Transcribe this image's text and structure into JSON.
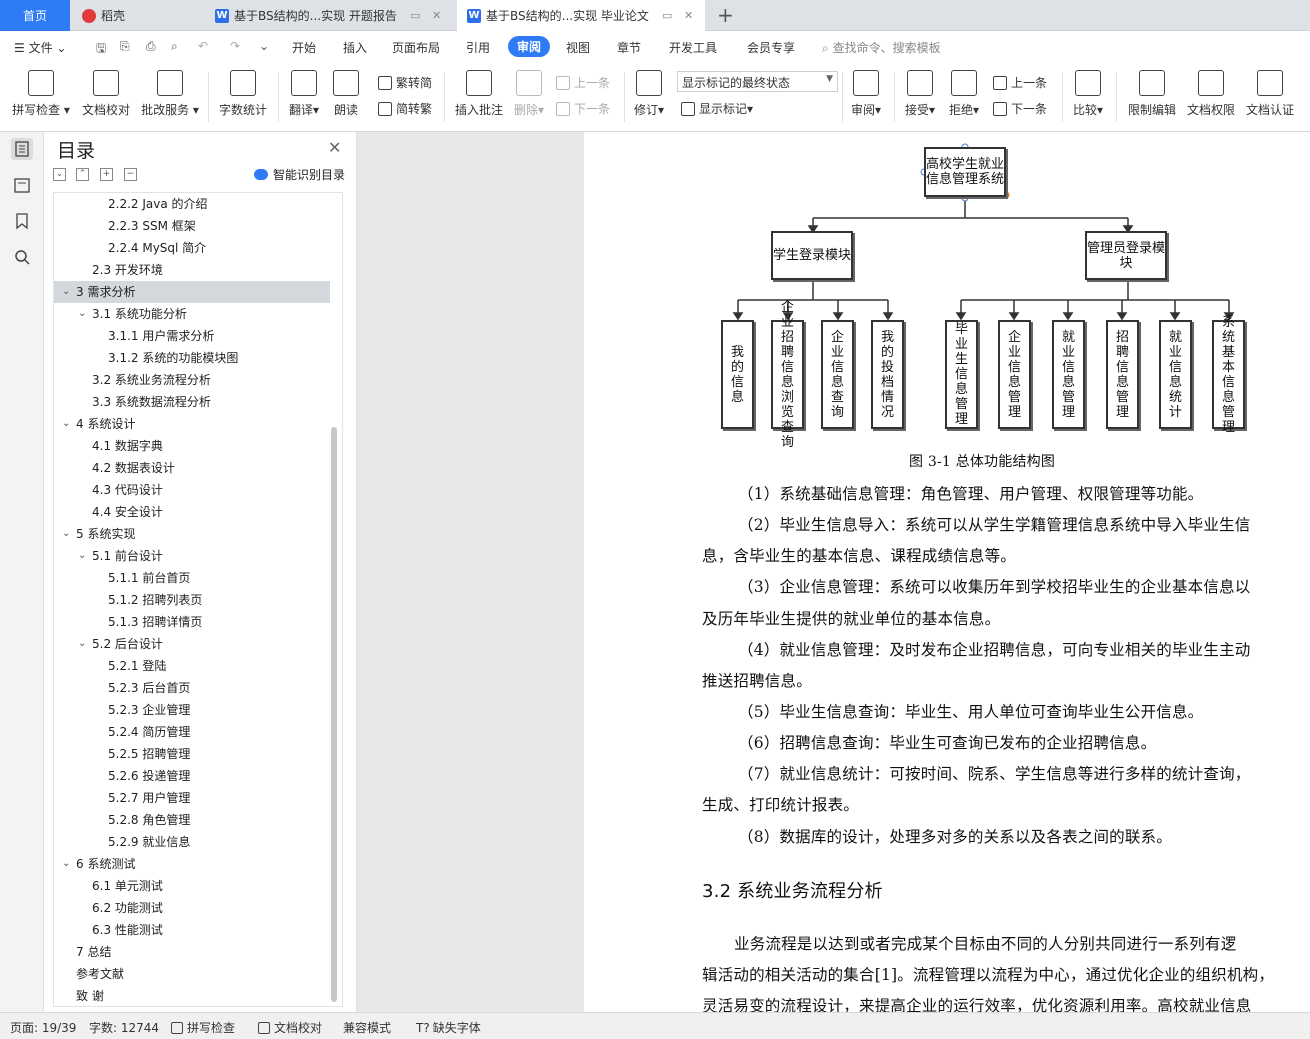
{
  "tabs": [
    {
      "label": "首页"
    },
    {
      "label": "稻壳"
    },
    {
      "label": "基于BS结构的...实现 开题报告"
    },
    {
      "label": "基于BS结构的...实现 毕业论文"
    }
  ],
  "menu": {
    "file": "文件",
    "items": [
      "开始",
      "插入",
      "页面布局",
      "引用",
      "审阅",
      "视图",
      "章节",
      "开发工具",
      "会员专享"
    ],
    "active": "审阅",
    "search_placeholder": "查找命令、搜索模板"
  },
  "ribbon": {
    "spell": "拼写检查",
    "doccheck": "文档校对",
    "correction": "批改服务",
    "wordcount": "字数统计",
    "translate": "翻译",
    "read": "朗读",
    "trad": "繁转简",
    "simp": "简转繁",
    "insert_comment": "插入批注",
    "delete": "删除",
    "prev_comment": "上一条",
    "next_comment": "下一条",
    "revise": "修订",
    "status_select": "显示标记的最终状态",
    "show_marks": "显示标记",
    "review": "审阅",
    "accept": "接受",
    "reject": "拒绝",
    "prev": "上一条",
    "next": "下一条",
    "compare": "比较",
    "restrict": "限制编辑",
    "permission": "文档权限",
    "auth": "文档认证"
  },
  "toc": {
    "title": "目录",
    "smart": "智能识别目录",
    "items": [
      {
        "text": "2.2.2 Java 的介绍",
        "level": 3
      },
      {
        "text": "2.2.3 SSM 框架",
        "level": 3
      },
      {
        "text": "2.2.4 MySql 简介",
        "level": 3
      },
      {
        "text": "2.3  开发环境",
        "level": 2
      },
      {
        "text": "3  需求分析",
        "level": 1,
        "expanded": true,
        "selected": true
      },
      {
        "text": "3.1  系统功能分析",
        "level": 2,
        "expanded": true
      },
      {
        "text": "3.1.1  用户需求分析",
        "level": 3
      },
      {
        "text": "3.1.2  系统的功能模块图",
        "level": 3
      },
      {
        "text": "3.2  系统业务流程分析",
        "level": 2
      },
      {
        "text": "3.3  系统数据流程分析",
        "level": 2
      },
      {
        "text": "4  系统设计",
        "level": 1,
        "expanded": true
      },
      {
        "text": "4.1  数据字典",
        "level": 2
      },
      {
        "text": "4.2  数据表设计",
        "level": 2
      },
      {
        "text": "4.3  代码设计",
        "level": 2
      },
      {
        "text": "4.4  安全设计",
        "level": 2
      },
      {
        "text": "5  系统实现",
        "level": 1,
        "expanded": true
      },
      {
        "text": "5.1  前台设计",
        "level": 2,
        "expanded": true
      },
      {
        "text": "5.1.1  前台首页",
        "level": 3
      },
      {
        "text": "5.1.2  招聘列表页",
        "level": 3
      },
      {
        "text": "5.1.3  招聘详情页",
        "level": 3
      },
      {
        "text": "5.2  后台设计",
        "level": 2,
        "expanded": true
      },
      {
        "text": "5.2.1  登陆",
        "level": 3
      },
      {
        "text": "5.2.3  后台首页",
        "level": 3
      },
      {
        "text": "5.2.3  企业管理",
        "level": 3
      },
      {
        "text": "5.2.4  简历管理",
        "level": 3
      },
      {
        "text": "5.2.5  招聘管理",
        "level": 3
      },
      {
        "text": "5.2.6  投递管理",
        "level": 3
      },
      {
        "text": "5.2.7  用户管理",
        "level": 3
      },
      {
        "text": "5.2.8  角色管理",
        "level": 3
      },
      {
        "text": "5.2.9  就业信息",
        "level": 3
      },
      {
        "text": "6  系统测试",
        "level": 1,
        "expanded": true
      },
      {
        "text": "6.1  单元测试",
        "level": 2
      },
      {
        "text": "6.2  功能测试",
        "level": 2
      },
      {
        "text": "6.3  性能测试",
        "level": 2
      },
      {
        "text": "7  总结",
        "level": 1
      },
      {
        "text": "参考文献",
        "level": 1
      },
      {
        "text": "致    谢",
        "level": 1
      }
    ]
  },
  "diagram": {
    "root": "高校学生就业信息管理系统",
    "modules": [
      "学生登录模块",
      "管理员登录模块"
    ],
    "student_leaves": [
      "我的信息",
      "企业招聘信息浏览查询",
      "企业信息查询",
      "我的投档情况"
    ],
    "admin_leaves": [
      "毕业生信息管理",
      "企业信息管理",
      "就业信息管理",
      "招聘信息管理",
      "就业信息统计",
      "系统基本信息管理"
    ],
    "caption": "图 3-1  总体功能结构图"
  },
  "document": {
    "lines": [
      "（1）系统基础信息管理：角色管理、用户管理、权限管理等功能。",
      "（2）毕业生信息导入：系统可以从学生学籍管理信息系统中导入毕业生信",
      "息，含毕业生的基本信息、课程成绩信息等。",
      "（3）企业信息管理：系统可以收集历年到学校招毕业生的企业基本信息以",
      "及历年毕业生提供的就业单位的基本信息。",
      "（4）就业信息管理：及时发布企业招聘信息，可向专业相关的毕业生主动",
      "推送招聘信息。",
      "（5）毕业生信息查询：毕业生、用人单位可查询毕业生公开信息。",
      "（6）招聘信息查询：毕业生可查询已发布的企业招聘信息。",
      "（7）就业信息统计：可按时间、院系、学生信息等进行多样的统计查询，",
      "生成、打印统计报表。",
      "（8）数据库的设计，处理多对多的关系以及各表之间的联系。"
    ],
    "heading": "3.2  系统业务流程分析",
    "body": [
      "业务流程是以达到或者完成某个目标由不同的人分别共同进行一系列有逻",
      "辑活动的相关活动的集合[1]。流程管理以流程为中心，通过优化企业的组织机构，",
      "灵活易变的流程设计，来提高企业的运行效率，优化资源利用率。高校就业信息"
    ]
  },
  "status": {
    "page": "页面: 19/39",
    "words": "字数: 12744",
    "spell": "拼写检查",
    "doccheck": "文档校对",
    "compat": "兼容模式",
    "missing_font": "缺失字体"
  }
}
